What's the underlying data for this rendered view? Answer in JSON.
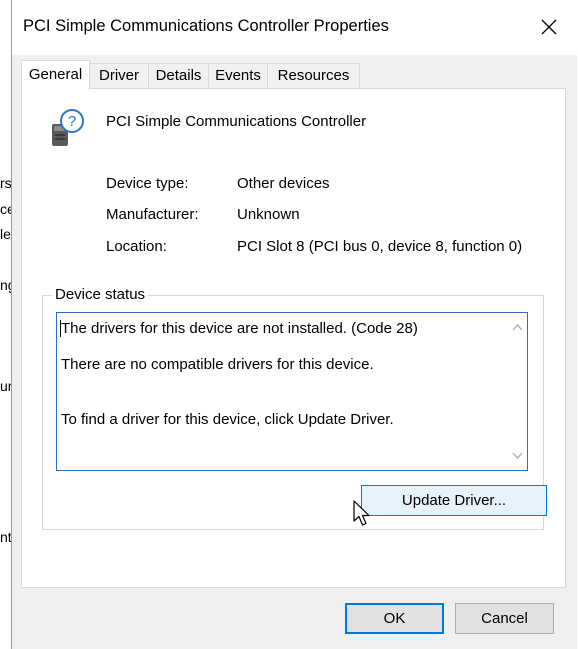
{
  "background_fragments": [
    "rs",
    "ce",
    "le",
    "ng",
    "ur",
    "nt"
  ],
  "dialog": {
    "title": "PCI Simple Communications Controller Properties"
  },
  "tabs": [
    {
      "label": "General",
      "active": true
    },
    {
      "label": "Driver",
      "active": false
    },
    {
      "label": "Details",
      "active": false
    },
    {
      "label": "Events",
      "active": false
    },
    {
      "label": "Resources",
      "active": false
    }
  ],
  "device": {
    "icon": "unknown-device-icon",
    "name": "PCI Simple Communications Controller"
  },
  "properties": [
    {
      "label": "Device type:",
      "value": "Other devices"
    },
    {
      "label": "Manufacturer:",
      "value": "Unknown"
    },
    {
      "label": "Location:",
      "value": "PCI Slot 8 (PCI bus 0, device 8, function 0)"
    }
  ],
  "device_status": {
    "label": "Device status",
    "lines": [
      "The drivers for this device are not installed. (Code 28)",
      "There are no compatible drivers for this device.",
      "To find a driver for this device, click Update Driver."
    ]
  },
  "buttons": {
    "update_driver": "Update Driver...",
    "ok": "OK",
    "cancel": "Cancel"
  },
  "colors": {
    "accent": "#0078d7",
    "dialog_bg": "#f0f0f0"
  }
}
